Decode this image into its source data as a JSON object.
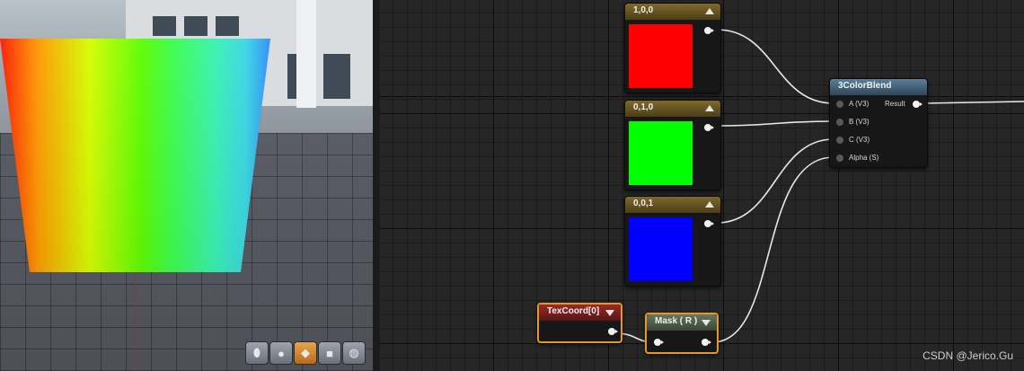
{
  "viewport": {
    "toolbar": [
      {
        "name": "cylinder-icon",
        "glyph": "⬮",
        "active": false
      },
      {
        "name": "sphere-icon",
        "glyph": "●",
        "active": false
      },
      {
        "name": "plane-icon",
        "glyph": "◆",
        "active": true
      },
      {
        "name": "cube-icon",
        "glyph": "■",
        "active": false
      },
      {
        "name": "teapot-icon",
        "glyph": "◍",
        "active": false
      }
    ]
  },
  "graph": {
    "nodes": {
      "const_red": {
        "title": "1,0,0",
        "color": "#ff0000"
      },
      "const_green": {
        "title": "0,1,0",
        "color": "#00ff00"
      },
      "const_blue": {
        "title": "0,0,1",
        "color": "#0000ff"
      },
      "blend": {
        "title": "3ColorBlend",
        "inputs": [
          "A (V3)",
          "B (V3)",
          "C (V3)",
          "Alpha (S)"
        ],
        "output": "Result"
      },
      "texcoord": {
        "title": "TexCoord[0]"
      },
      "mask": {
        "title": "Mask ( R )"
      }
    }
  },
  "watermark": "CSDN @Jerico.Gu"
}
